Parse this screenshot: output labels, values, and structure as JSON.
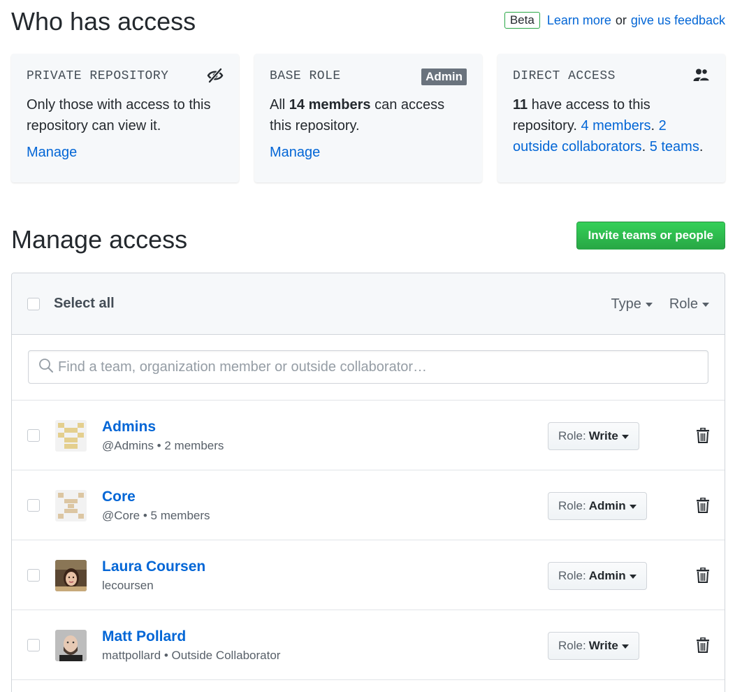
{
  "header": {
    "title": "Who has access",
    "beta_badge": "Beta",
    "learn_more": "Learn more",
    "or_text": "or",
    "feedback": "give us feedback"
  },
  "cards": {
    "private": {
      "label": "PRIVATE REPOSITORY",
      "text": "Only those with access to this repository can view it.",
      "manage": "Manage",
      "icon": "eye-closed-icon"
    },
    "base_role": {
      "label": "BASE ROLE",
      "badge": "Admin",
      "text_pre": "All",
      "text_bold": "14 members",
      "text_post": "can access this repository.",
      "manage": "Manage"
    },
    "direct": {
      "label": "DIRECT ACCESS",
      "icon": "people-icon",
      "count": "11",
      "text_mid": "have access to this repository.",
      "members_link": "4 members",
      "collab_link": "2 outside collaborators",
      "teams_link": "5 teams"
    }
  },
  "manage": {
    "title": "Manage access",
    "invite_button": "Invite teams or people",
    "select_all": "Select all",
    "filter_type": "Type",
    "filter_role": "Role",
    "search_placeholder": "Find a team, organization member or outside collaborator…"
  },
  "rows": [
    {
      "name": "Admins",
      "handle": "@Admins",
      "detail": "2 members",
      "role_prefix": "Role:",
      "role": "Write",
      "avatar": "team-identicon-yellow"
    },
    {
      "name": "Core",
      "handle": "@Core",
      "detail": "5 members",
      "role_prefix": "Role:",
      "role": "Admin",
      "avatar": "team-identicon-tan"
    },
    {
      "name": "Laura Coursen",
      "handle": "lecoursen",
      "detail": "",
      "role_prefix": "Role:",
      "role": "Admin",
      "avatar": "user-photo"
    },
    {
      "name": "Matt Pollard",
      "handle": "mattpollard",
      "detail": "Outside Collaborator",
      "role_prefix": "Role:",
      "role": "Write",
      "avatar": "user-photo"
    }
  ],
  "colors": {
    "link": "#0366d6",
    "invite_green": "#28a745",
    "badge_gray": "#6a737d",
    "card_bg": "#f6f8fa"
  }
}
